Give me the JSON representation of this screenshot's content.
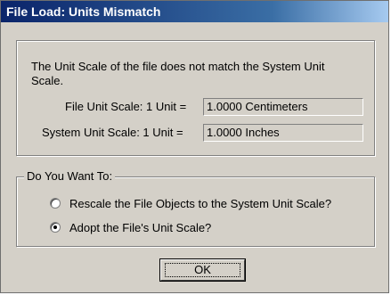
{
  "dialog": {
    "title": "File Load: Units Mismatch",
    "message": "The Unit Scale of the file does not match the System Unit Scale.",
    "file_unit_label": "File Unit Scale:  1 Unit =",
    "file_unit_value": "1.0000 Centimeters",
    "system_unit_label": "System Unit Scale:  1 Unit =",
    "system_unit_value": "1.0000 Inches",
    "group_label": "Do You Want To:",
    "options": [
      {
        "label": "Rescale the File Objects to the System Unit Scale?",
        "selected": false
      },
      {
        "label": "Adopt the File's Unit Scale?",
        "selected": true
      }
    ],
    "ok_label": "OK"
  },
  "colors": {
    "title_bar_start": "#0a246a",
    "title_bar_end": "#a6caf0",
    "dialog_bg": "#d4d0c8"
  }
}
